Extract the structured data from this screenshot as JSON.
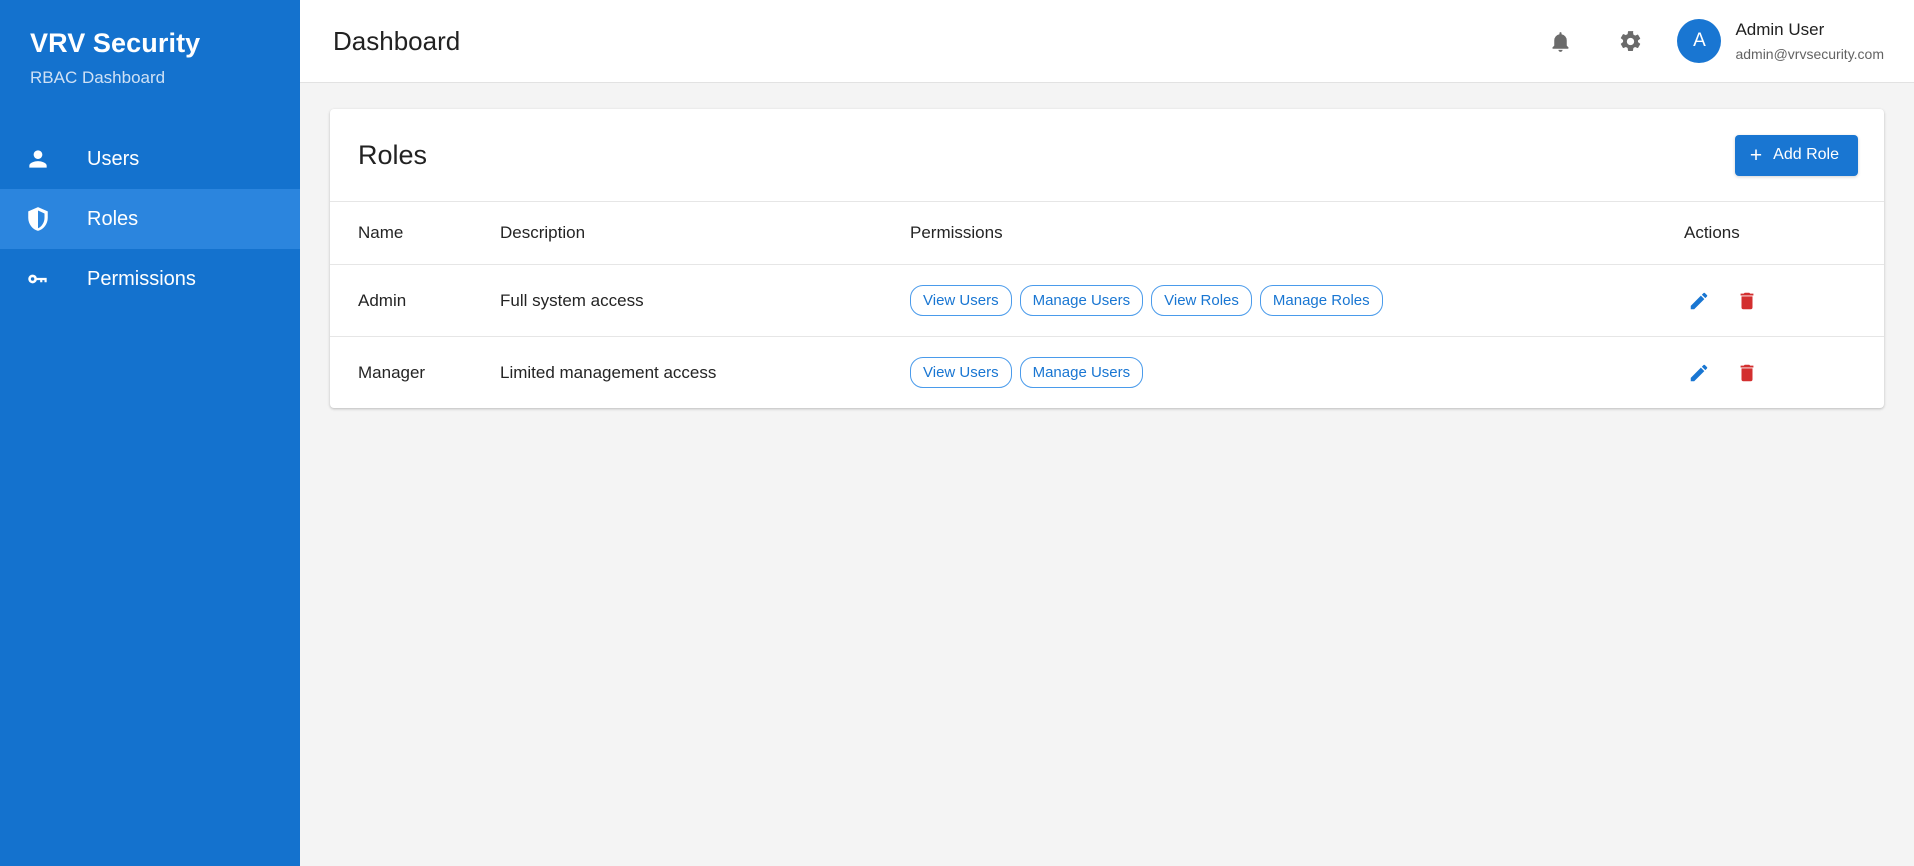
{
  "sidebar": {
    "brand_title": "VRV Security",
    "brand_subtitle": "RBAC Dashboard",
    "items": [
      {
        "label": "Users",
        "icon": "person-icon",
        "active": false
      },
      {
        "label": "Roles",
        "icon": "shield-icon",
        "active": true
      },
      {
        "label": "Permissions",
        "icon": "key-icon",
        "active": false
      }
    ]
  },
  "header": {
    "title": "Dashboard",
    "notifications_icon": "bell-icon",
    "settings_icon": "gear-icon",
    "user": {
      "avatar_initial": "A",
      "name": "Admin User",
      "email": "admin@vrvsecurity.com"
    }
  },
  "card": {
    "title": "Roles",
    "add_button_label": "Add Role",
    "add_button_icon": "plus-icon"
  },
  "table": {
    "columns": [
      "Name",
      "Description",
      "Permissions",
      "Actions"
    ],
    "rows": [
      {
        "name": "Admin",
        "description": "Full system access",
        "permissions": [
          "View Users",
          "Manage Users",
          "View Roles",
          "Manage Roles"
        ],
        "actions": [
          "edit-icon",
          "delete-icon"
        ]
      },
      {
        "name": "Manager",
        "description": "Limited management access",
        "permissions": [
          "View Users",
          "Manage Users"
        ],
        "actions": [
          "edit-icon",
          "delete-icon"
        ]
      }
    ]
  },
  "colors": {
    "sidebar_bg": "#1472ce",
    "sidebar_active_bg": "#2b85de",
    "primary": "#1976d2",
    "chip_border": "#4a9beb",
    "delete_red": "#d32f2f",
    "page_bg": "#f4f4f4"
  }
}
